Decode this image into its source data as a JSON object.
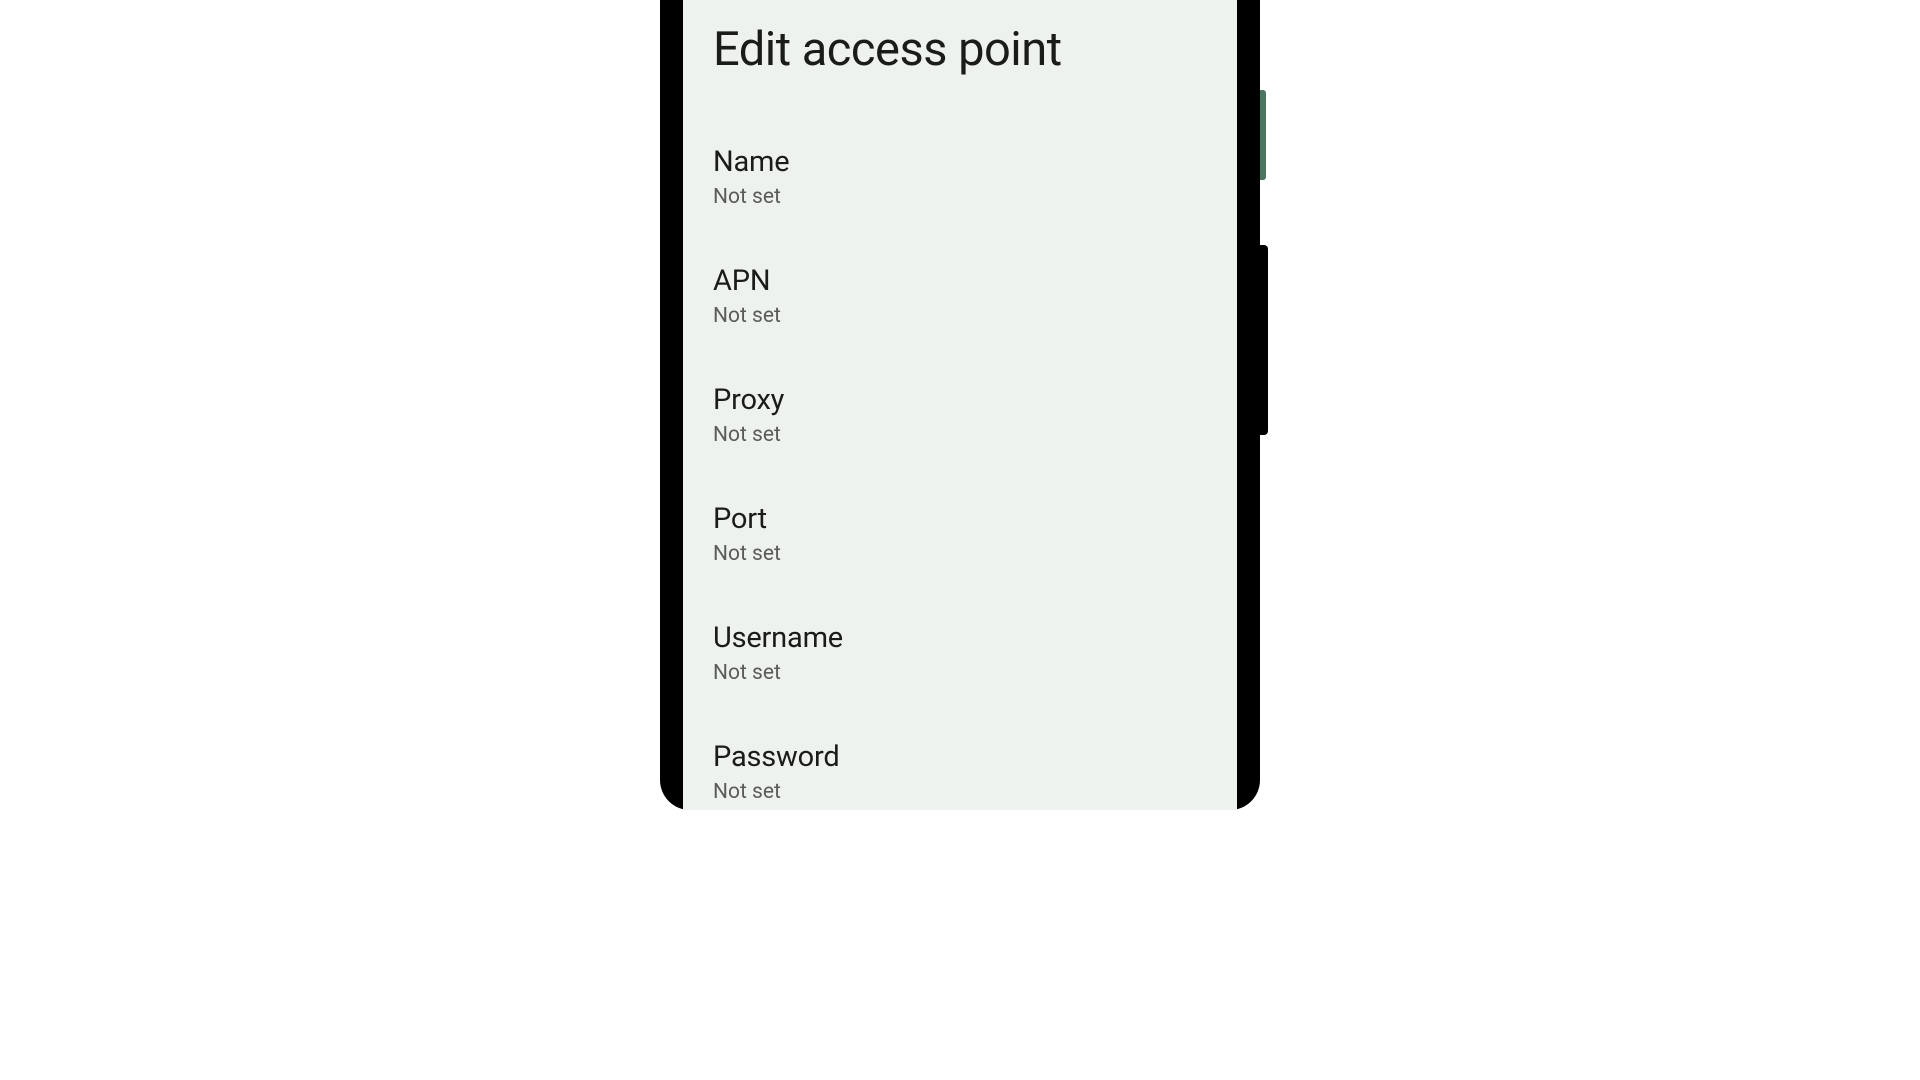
{
  "header": {
    "title": "Edit access point"
  },
  "settings": {
    "name": {
      "label": "Name",
      "value": "Not set"
    },
    "apn": {
      "label": "APN",
      "value": "Not set"
    },
    "proxy": {
      "label": "Proxy",
      "value": "Not set"
    },
    "port": {
      "label": "Port",
      "value": "Not set"
    },
    "username": {
      "label": "Username",
      "value": "Not set"
    },
    "password": {
      "label": "Password",
      "value": "Not set"
    }
  }
}
